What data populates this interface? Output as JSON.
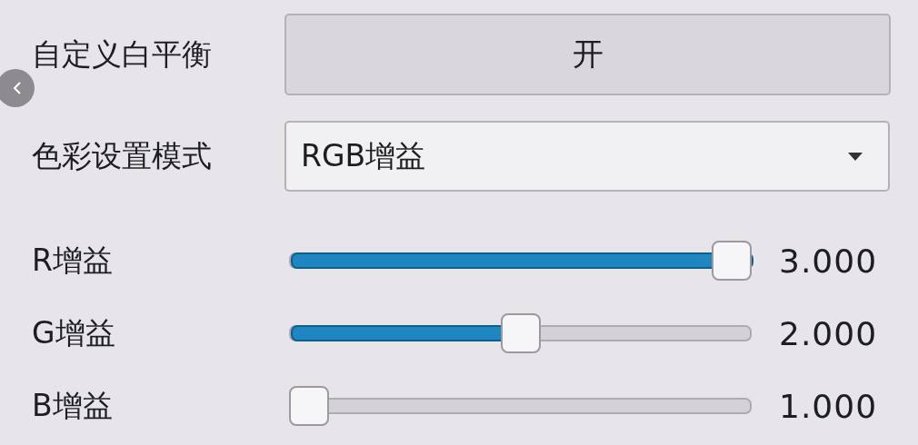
{
  "rows": [
    {
      "kind": "toggle",
      "label": "自定义白平衡",
      "value": "开"
    },
    {
      "kind": "dropdown",
      "label": "色彩设置模式",
      "value": "RGB增益"
    },
    {
      "kind": "slider",
      "label": "R增益",
      "level": 1,
      "reading": "3.000"
    },
    {
      "kind": "slider",
      "label": "G增益",
      "level": 0.5,
      "reading": "2.000"
    },
    {
      "kind": "slider",
      "label": "B增益",
      "level": 0,
      "reading": "1.000"
    }
  ]
}
